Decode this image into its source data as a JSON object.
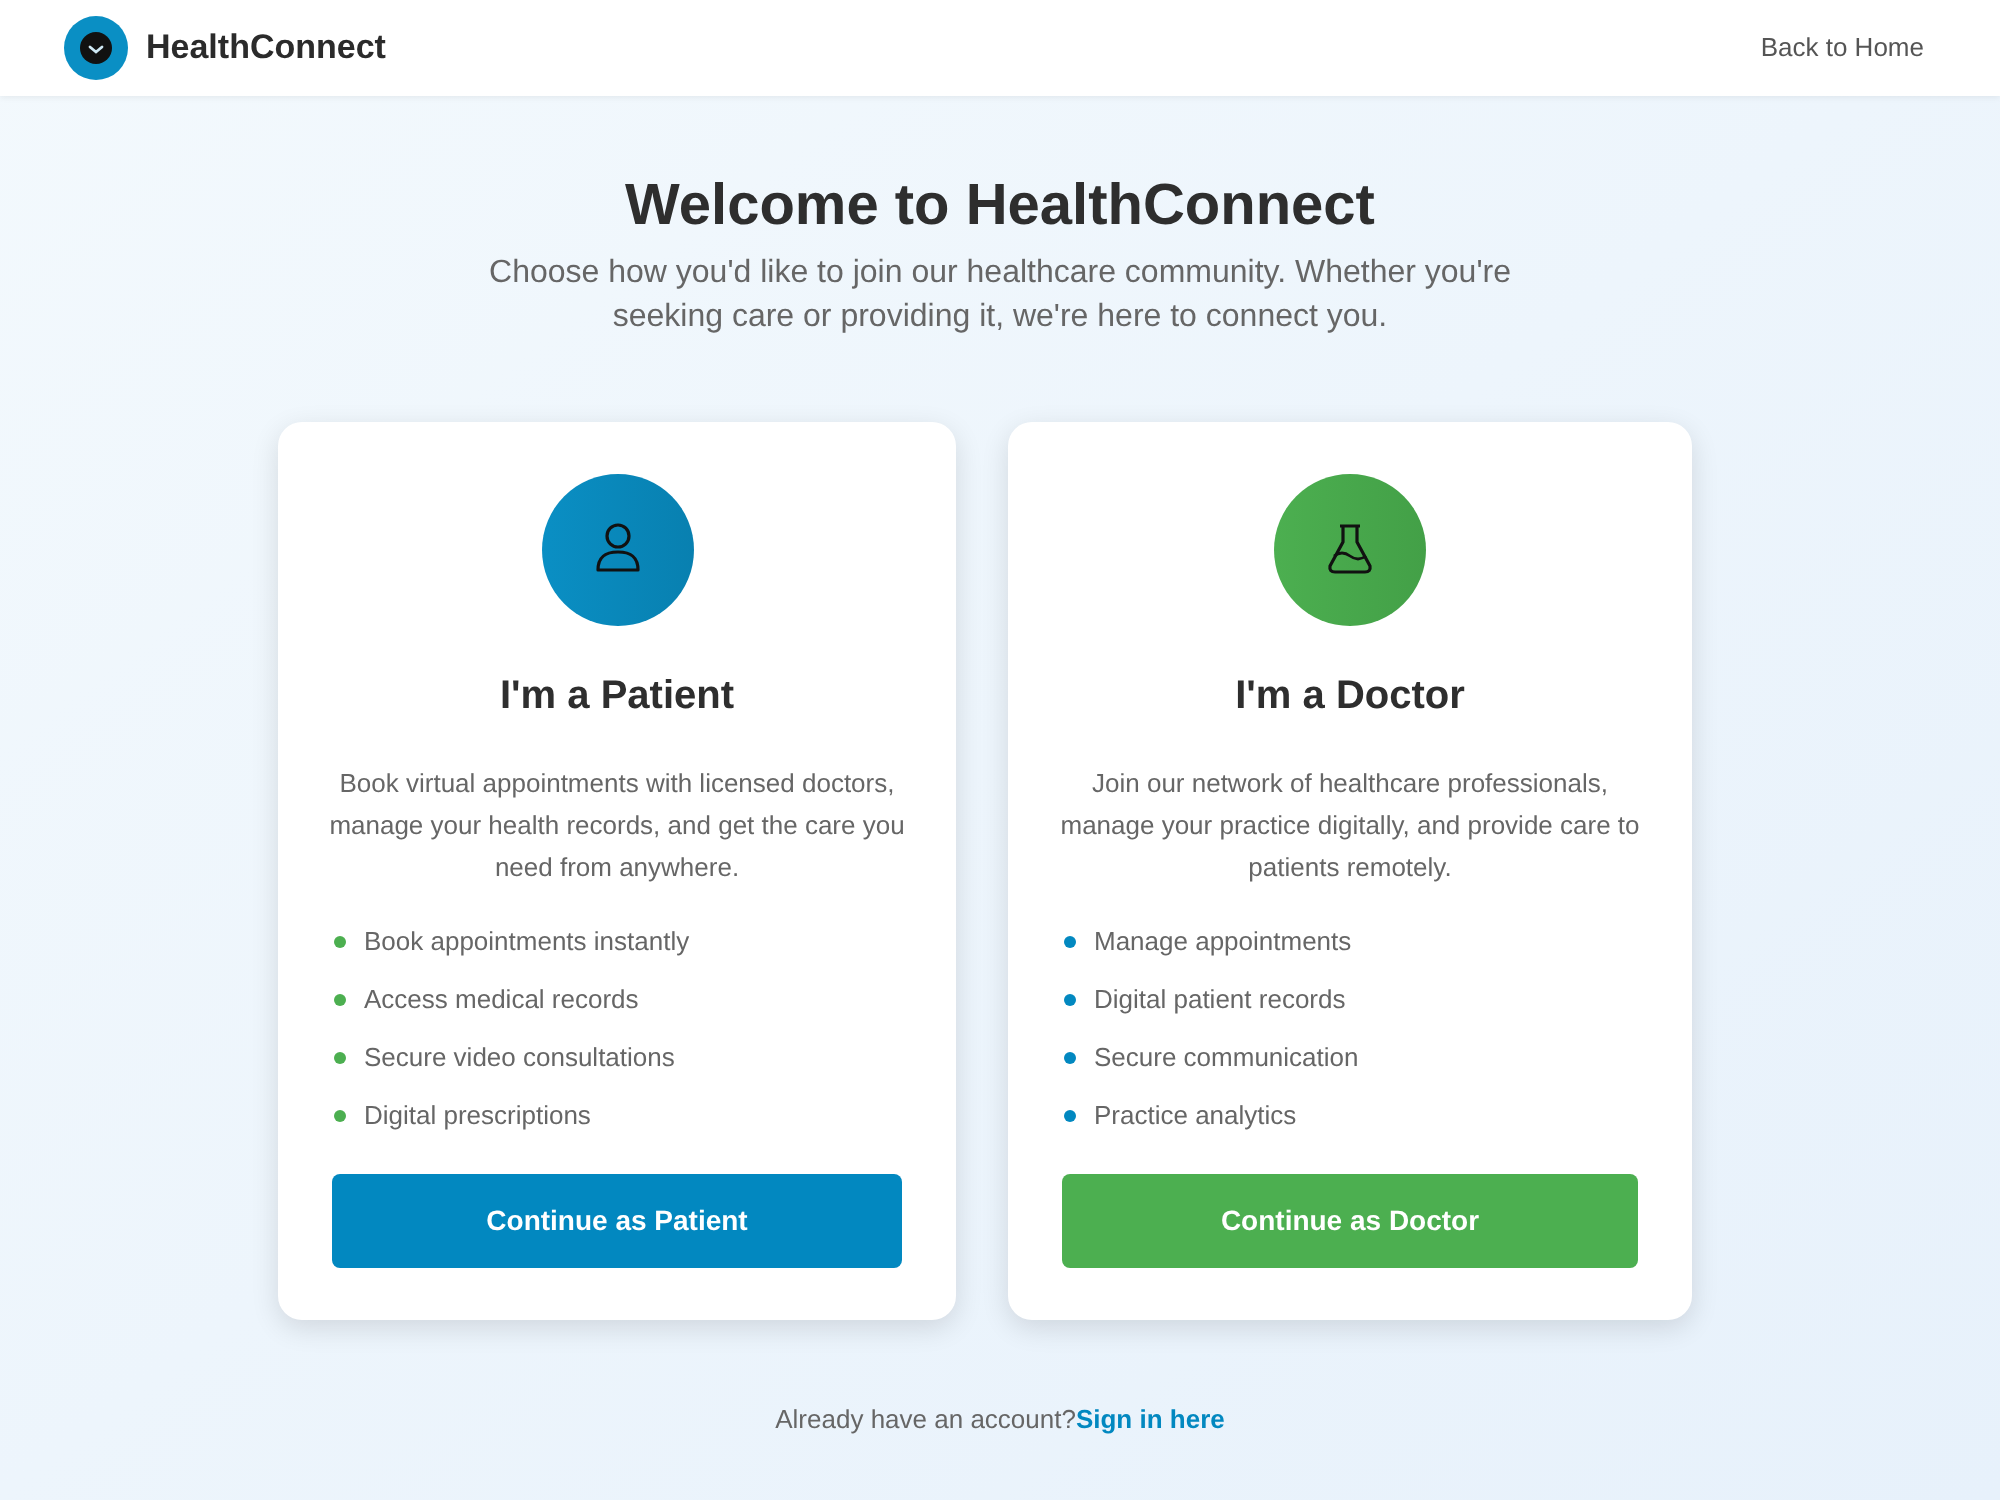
{
  "header": {
    "brand": "HealthConnect",
    "back_link": "Back to Home"
  },
  "hero": {
    "title": "Welcome to HealthConnect",
    "subtitle": "Choose how you'd like to join our healthcare community. Whether you're seeking care or providing it, we're here to connect you."
  },
  "cards": [
    {
      "kind": "patient",
      "title": "I'm a Patient",
      "description": "Book virtual appointments with licensed doctors, manage your health records, and get the care you need from anywhere.",
      "features": [
        "Book appointments instantly",
        "Access medical records",
        "Secure video consultations",
        "Digital prescriptions"
      ],
      "button": "Continue as Patient"
    },
    {
      "kind": "doctor",
      "title": "I'm a Doctor",
      "description": "Join our network of healthcare professionals, manage your practice digitally, and provide care to patients remotely.",
      "features": [
        "Manage appointments",
        "Digital patient records",
        "Secure communication",
        "Practice analytics"
      ],
      "button": "Continue as Doctor"
    }
  ],
  "footer": {
    "prompt": "Already have an account?",
    "link": "Sign in here"
  }
}
